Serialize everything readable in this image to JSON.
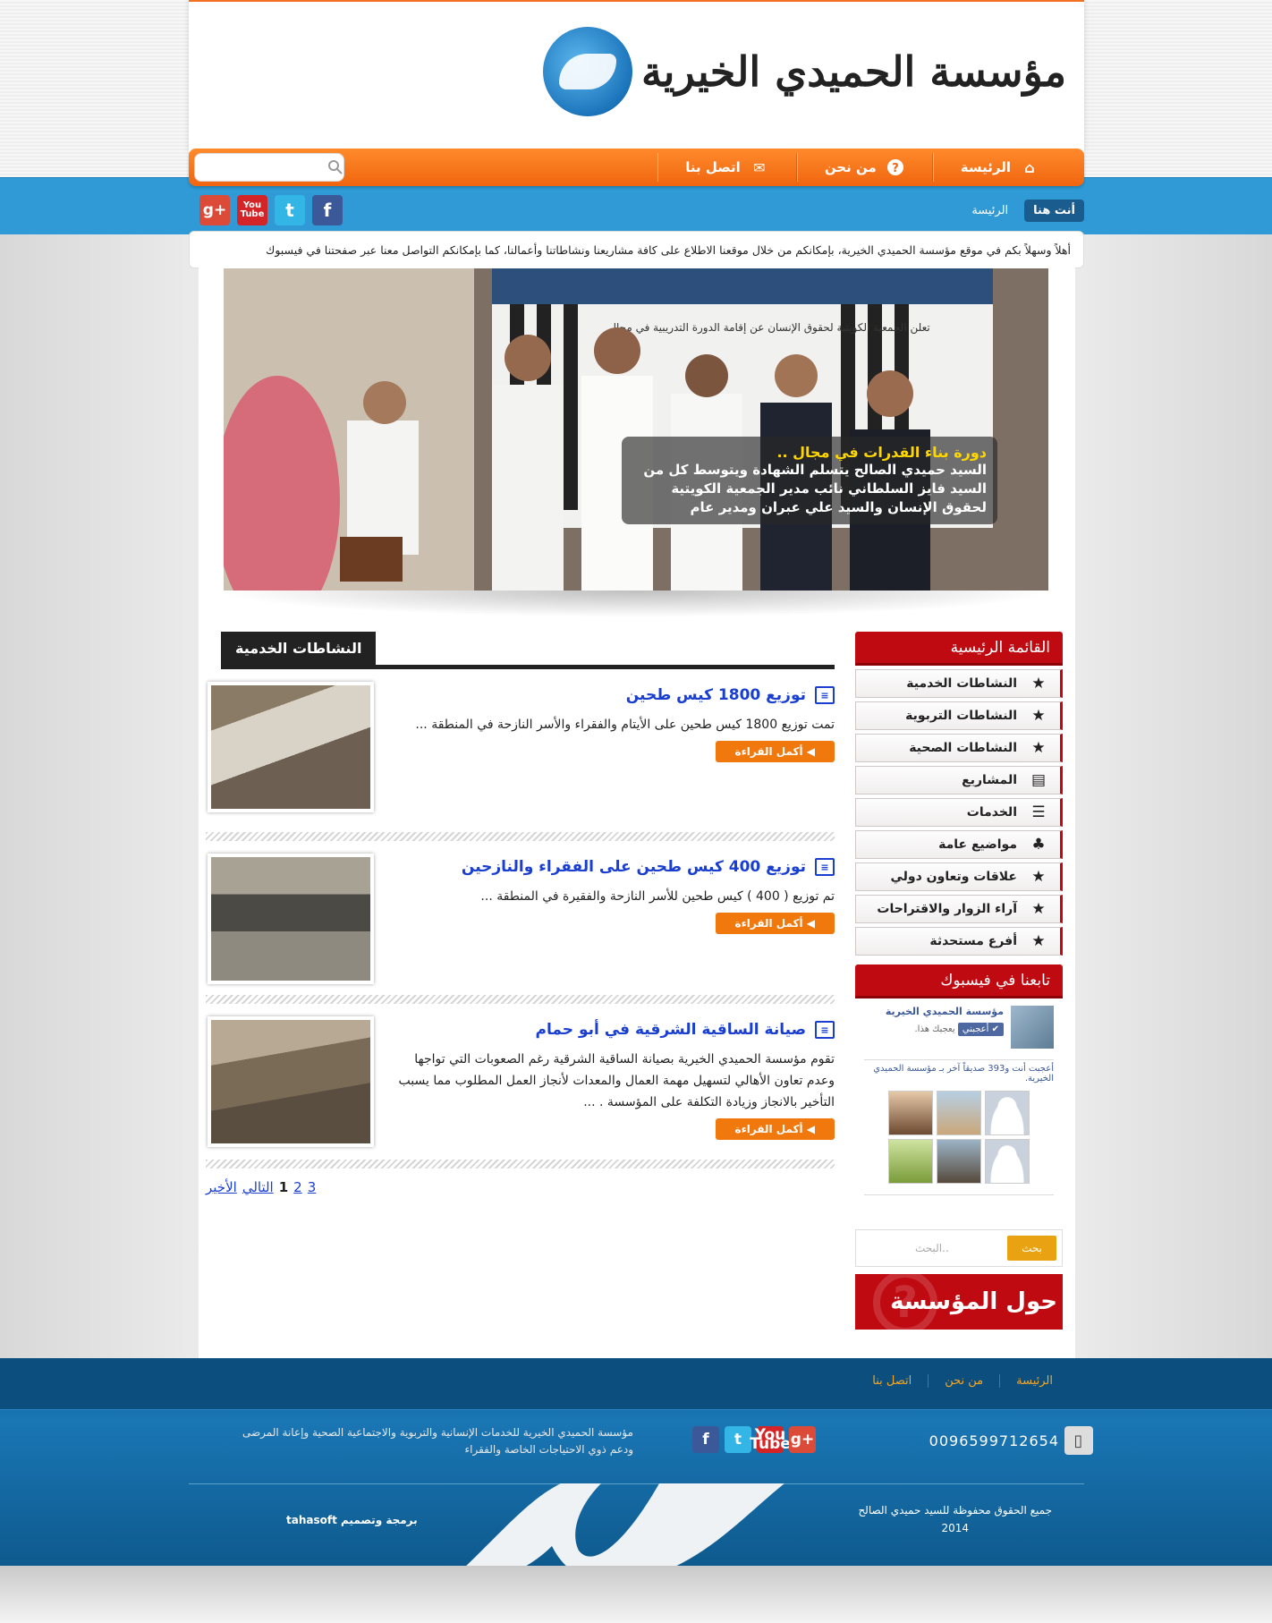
{
  "brand": {
    "logo_text": "مؤسسة الحميدي الخيرية"
  },
  "nav": {
    "items": [
      {
        "label": "الرئيسة",
        "icon": "home-icon"
      },
      {
        "label": "من نحن",
        "icon": "question-icon"
      },
      {
        "label": "اتصل بنا",
        "icon": "envelope-icon"
      }
    ]
  },
  "breadcrumb": {
    "you_are_here": "أنت هنا",
    "current": "الرئيسة"
  },
  "ticker": "أهلاً وسهلاً بكم في موقع مؤسسة الحميدي الخيرية، بإمكانكم من خلال موقعنا الاطلاع على كافة مشاريعنا ونشاطاتنا وأعمالنا، كما بإمكانكم التواصل معنا عبر صفحتنا في فيسبوك",
  "slider": {
    "title": "دورة بناء القدرات في مجال ..",
    "text": "السيد حميدي الصالح يتسلم الشهادة ويتوسط كل من السيد فايز السلطاني نائب مدير الجمعية الكويتية لحقوق الإنسان والسيد علي عبران ومدير عام",
    "banner": "تعلن الجمعية الكويتية لحقوق الإنسان عن إقامة الدورة التدريبية في مجال"
  },
  "content": {
    "section_title": "النشاطات الخدمية",
    "articles": [
      {
        "title": "توزيع 1800 كيس طحين",
        "text": "تمت توزيع 1800 كيس طحين على الأيتام والفقراء والأسر النازحة في المنطقة ...",
        "readmore": "أكمل القراءة"
      },
      {
        "title": "توزيع 400 كيس طحين على الفقراء والنازحين",
        "text": "تم توزيع ( 400 ) كيس طحين للأسر النازحة والفقيرة في المنطقة ...",
        "readmore": "أكمل القراءة"
      },
      {
        "title": "صيانة الساقية الشرقية في أبو حمام",
        "text": "تقوم مؤسسة الحميدي الخيرية بصيانة الساقية الشرقية رغم الصعوبات التي تواجها وعدم تعاون الأهالي لتسهيل مهمة العمال والمعدات لأنجاز العمل المطلوب مما يسبب التأخير بالانجاز وزيادة التكلفة على المؤسسة . ...",
        "readmore": "أكمل القراءة"
      }
    ],
    "pager": {
      "p1": "1",
      "p2": "2",
      "p3": "3",
      "next": "التالي",
      "last": "الأخير"
    }
  },
  "sidebar": {
    "menu_title": "القائمة الرئيسية",
    "menu": [
      {
        "label": "النشاطات الخدمية",
        "icon": "star-icon"
      },
      {
        "label": "النشاطات التربوية",
        "icon": "star-icon"
      },
      {
        "label": "النشاطات الصحية",
        "icon": "star-icon"
      },
      {
        "label": "المشاريع",
        "icon": "note-icon"
      },
      {
        "label": "الخدمات",
        "icon": "list-icon"
      },
      {
        "label": "مواضيع عامة",
        "icon": "people-icon"
      },
      {
        "label": "علاقات وتعاون دولي",
        "icon": "star-icon"
      },
      {
        "label": "آراء الزوار والاقتراحات",
        "icon": "star-icon"
      },
      {
        "label": "أفرع مستحدثة",
        "icon": "star-icon"
      }
    ],
    "facebook_title": "تابعنا في فيسبوك",
    "fb": {
      "page_name": "مؤسسة الحميدي الخيرية",
      "like_label": "أعجبني",
      "liked_text": "يعجبك هذا.",
      "friends_text": "أعجبت أنت و393 صديقاً آخر بـ مؤسسة الحميدي الخيرية."
    },
    "search": {
      "placeholder": "..البحث",
      "button": "بحث"
    },
    "about": "حول المؤسسة"
  },
  "footer": {
    "links": [
      "الرئيسة",
      "من نحن",
      "اتصل بنا"
    ],
    "phone": "0096599712654",
    "about": "مؤسسة الحميدي الخيرية للخدمات الإنسانية والتربوية والاجتماعية الصحية وإعانة المرضى ودعم ذوي الاحتياجات الخاصة والفقراء",
    "copyright_line1": "جميع الحقوق محفوظة للسيد حميدي الصالح",
    "copyright_line2": "2014",
    "design_credit": "برمجة وتصميم tahasoft"
  },
  "colors": {
    "accent_orange": "#f37021",
    "brand_blue": "#2f9ad6",
    "sidebar_red": "#c00a12",
    "link_blue": "#1a3fd0"
  }
}
